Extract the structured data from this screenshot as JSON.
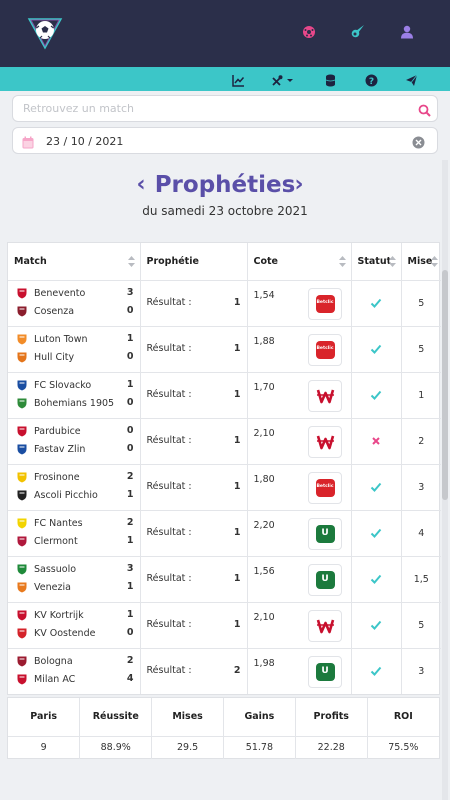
{
  "colors": {
    "topbar": "#2b2f4a",
    "accent_bar": "#3cc6c8",
    "title": "#5a4fa8",
    "success": "#3cc6c8",
    "fail": "#e8478a"
  },
  "header": {
    "logo": "soccer-ball-logo",
    "icons": [
      "soccer-ball-icon",
      "comet-icon",
      "user-icon"
    ]
  },
  "toolbar": {
    "icons": [
      "chart-icon",
      "tools-dropdown-icon",
      "database-icon",
      "help-icon",
      "telegram-icon"
    ]
  },
  "search": {
    "placeholder": "Retrouvez un match",
    "value": ""
  },
  "date_picker": {
    "value": "23 / 10 / 2021"
  },
  "page": {
    "title": "Prophéties",
    "subtitle": "du samedi 23 octobre 2021"
  },
  "table": {
    "headers": {
      "match": "Match",
      "prophecy": "Prophétie",
      "cote": "Cote",
      "status": "Statut",
      "mise": "Mise"
    },
    "rows": [
      {
        "home": "Benevento",
        "away": "Cosenza",
        "home_score": "3",
        "away_score": "0",
        "home_color": "#c8102e",
        "away_color": "#8b1e2d",
        "label": "Résultat :",
        "result": "1",
        "cote": "1,54",
        "bookmaker": "betclic",
        "status": "win",
        "mise": "5"
      },
      {
        "home": "Luton Town",
        "away": "Hull City",
        "home_score": "1",
        "away_score": "0",
        "home_color": "#f28c28",
        "away_color": "#e4751b",
        "label": "Résultat :",
        "result": "1",
        "cote": "1,88",
        "bookmaker": "betclic",
        "status": "win",
        "mise": "5"
      },
      {
        "home": "FC Slovacko",
        "away": "Bohemians 1905",
        "home_score": "1",
        "away_score": "0",
        "home_color": "#1a4ea2",
        "away_color": "#2e8b3a",
        "label": "Résultat :",
        "result": "1",
        "cote": "1,70",
        "bookmaker": "winamax",
        "status": "win",
        "mise": "1"
      },
      {
        "home": "Pardubice",
        "away": "Fastav Zlin",
        "home_score": "0",
        "away_score": "0",
        "home_color": "#c8102e",
        "away_color": "#1a4ea2",
        "label": "Résultat :",
        "result": "1",
        "cote": "2,10",
        "bookmaker": "winamax",
        "status": "loss",
        "mise": "2"
      },
      {
        "home": "Frosinone",
        "away": "Ascoli Picchio",
        "home_score": "2",
        "away_score": "1",
        "home_color": "#f2c200",
        "away_color": "#222222",
        "label": "Résultat :",
        "result": "1",
        "cote": "1,80",
        "bookmaker": "betclic",
        "status": "win",
        "mise": "3"
      },
      {
        "home": "FC Nantes",
        "away": "Clermont",
        "home_score": "2",
        "away_score": "1",
        "home_color": "#f2d400",
        "away_color": "#b0183c",
        "label": "Résultat :",
        "result": "1",
        "cote": "2,20",
        "bookmaker": "unibet",
        "status": "win",
        "mise": "4"
      },
      {
        "home": "Sassuolo",
        "away": "Venezia",
        "home_score": "3",
        "away_score": "1",
        "home_color": "#1f8a3a",
        "away_color": "#e87a1e",
        "label": "Résultat :",
        "result": "1",
        "cote": "1,56",
        "bookmaker": "unibet",
        "status": "win",
        "mise": "1,5"
      },
      {
        "home": "KV Kortrijk",
        "away": "KV Oostende",
        "home_score": "1",
        "away_score": "0",
        "home_color": "#c8102e",
        "away_color": "#d4232a",
        "label": "Résultat :",
        "result": "1",
        "cote": "2,10",
        "bookmaker": "winamax",
        "status": "win",
        "mise": "5"
      },
      {
        "home": "Bologna",
        "away": "Milan AC",
        "home_score": "2",
        "away_score": "4",
        "home_color": "#9b1b30",
        "away_color": "#c8102e",
        "label": "Résultat :",
        "result": "2",
        "cote": "1,98",
        "bookmaker": "unibet",
        "status": "win",
        "mise": "3"
      }
    ]
  },
  "bookmaker_labels": {
    "betclic": "Betclic",
    "unibet": "U"
  },
  "stats": {
    "headers": [
      "Paris",
      "Réussite",
      "Mises",
      "Gains",
      "Profits",
      "ROI"
    ],
    "values": [
      "9",
      "88.9%",
      "29.5",
      "51.78",
      "22.28",
      "75.5%"
    ]
  }
}
